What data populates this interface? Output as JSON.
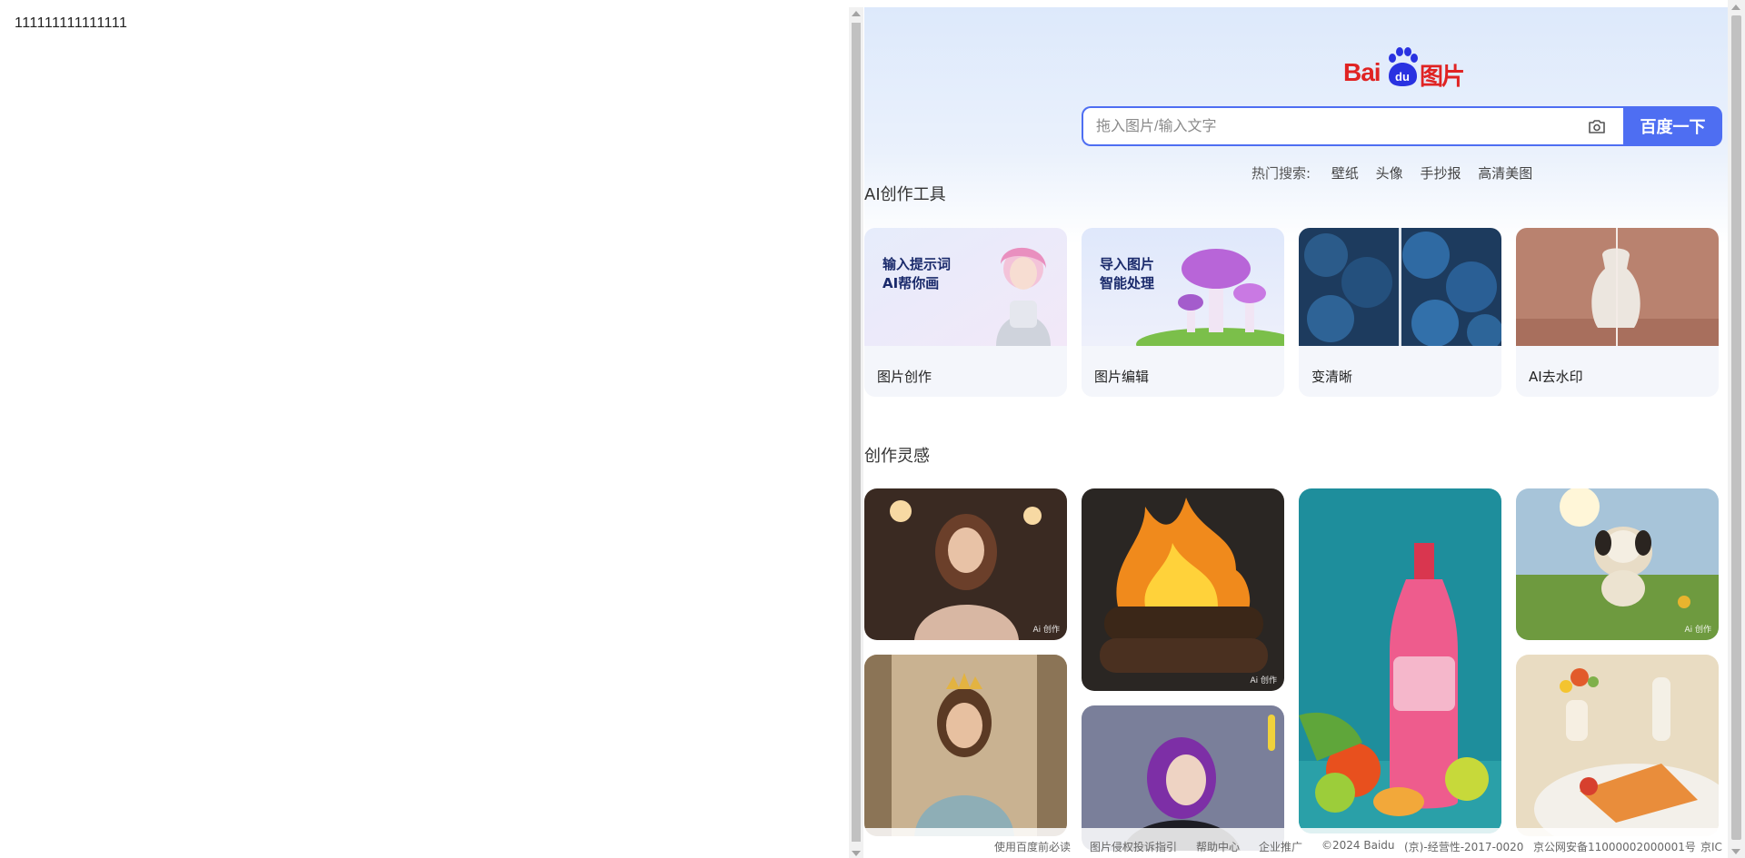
{
  "left_text": "111111111111111",
  "logo": {
    "bai": "Bai",
    "du": "du",
    "pic": "图片"
  },
  "search": {
    "placeholder": "拖入图片/输入文字",
    "button_label": "百度一下",
    "camera_icon": "camera-icon"
  },
  "hot_search": {
    "label": "热门搜索:",
    "items": [
      "壁纸",
      "头像",
      "手抄报",
      "高清美图"
    ]
  },
  "ai_tools": {
    "title": "AI创作工具",
    "cards": [
      {
        "name": "图片创作",
        "overlay": "输入提示词\nAI帮你画"
      },
      {
        "name": "图片编辑",
        "overlay": "导入图片\n智能处理"
      },
      {
        "name": "变清晰",
        "overlay": ""
      },
      {
        "name": "AI去水印",
        "overlay": ""
      }
    ]
  },
  "inspiration": {
    "title": "创作灵感",
    "badge": "Ai 创作",
    "tiles": [
      "woman-in-cafe",
      "burning-logs",
      "pink-bottle-fruits",
      "running-dog",
      "queen-portrait",
      "purple-hair-girl",
      "food-plate"
    ]
  },
  "footer": {
    "links": [
      "使用百度前必读",
      "图片侵权投诉指引",
      "帮助中心",
      "企业推广",
      "©2024 Baidu",
      "(京)-经营性-2017-0020",
      "京公网安备11000002000001号",
      "京IC"
    ]
  },
  "colors": {
    "brand_red": "#e02323",
    "brand_blue": "#2932e1",
    "accent": "#4e6ef2"
  }
}
